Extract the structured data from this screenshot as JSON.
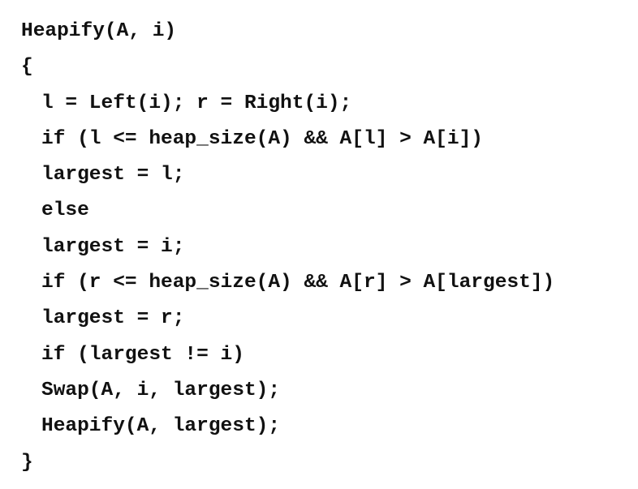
{
  "code": {
    "lines": [
      "Heapify(A, i)",
      "{",
      "l = Left(i); r = Right(i);",
      "if (l <= heap_size(A) && A[l] > A[i])",
      "largest = l;",
      "else",
      "largest = i;",
      "if (r <= heap_size(A) && A[r] > A[largest])",
      "largest = r;",
      "if (largest != i)",
      "Swap(A, i, largest);",
      "Heapify(A, largest);",
      "}"
    ]
  }
}
